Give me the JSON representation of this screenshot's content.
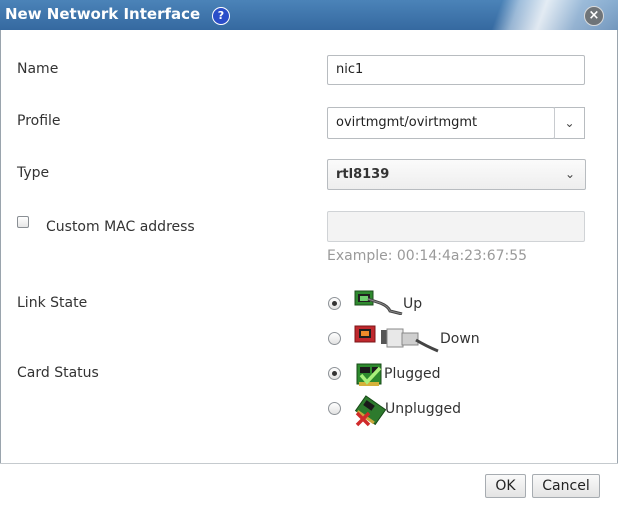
{
  "dialog": {
    "title": "New Network Interface",
    "help_icon": "?",
    "close_icon": "×"
  },
  "form": {
    "name_label": "Name",
    "name_value": "nic1",
    "profile_label": "Profile",
    "profile_value": "ovirtmgmt/ovirtmgmt",
    "type_label": "Type",
    "type_value": "rtl8139",
    "custom_mac_label": "Custom MAC address",
    "custom_mac_checked": false,
    "mac_value": "",
    "mac_example": "Example: 00:14:4a:23:67:55",
    "link_state_label": "Link State",
    "link_state_options": [
      {
        "label": "Up",
        "icon": "network-cable-up-icon",
        "checked": true
      },
      {
        "label": "Down",
        "icon": "network-cable-down-icon",
        "checked": false
      }
    ],
    "card_status_label": "Card Status",
    "card_status_options": [
      {
        "label": "Plugged",
        "icon": "card-plugged-icon",
        "checked": true
      },
      {
        "label": "Unplugged",
        "icon": "card-unplugged-icon",
        "checked": false
      }
    ]
  },
  "footer": {
    "ok_label": "OK",
    "cancel_label": "Cancel"
  },
  "colors": {
    "titlebar": "#3c72a8",
    "text": "#333333",
    "placeholder": "#9a9a9a"
  }
}
